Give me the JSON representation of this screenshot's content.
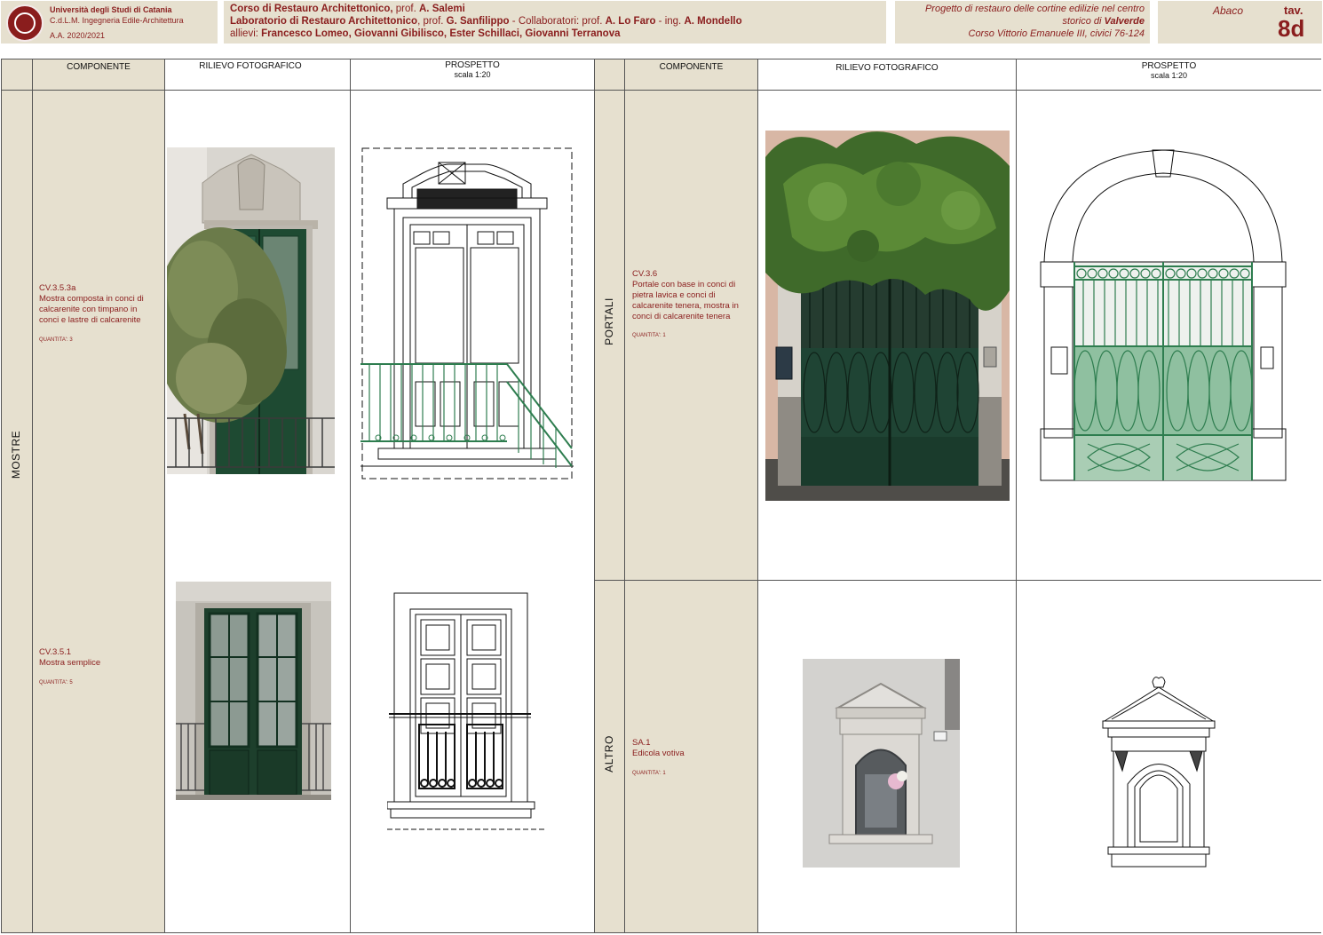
{
  "header": {
    "university": "Università degli Studi di Catania",
    "degree": "C.d.L.M. Ingegneria Edile-Architettura",
    "year": "A.A. 2020/2021",
    "course_line1_a": "Corso di Restauro Architettonico,",
    "course_line1_b": " prof. ",
    "course_line1_c": "A. Salemi",
    "course_line2_a": "Laboratorio di Restauro Architettonico",
    "course_line2_b": ", prof. ",
    "course_line2_c": "G. Sanfilippo",
    "course_line2_d": " - Collaboratori: prof. ",
    "course_line2_e": "A. Lo Faro",
    "course_line2_f": " - ing. ",
    "course_line2_g": "A. Mondello",
    "course_line3_a": "allievi: ",
    "course_line3_b": " Francesco Lomeo, Giovanni Gibilisco, Ester Schillaci, Giovanni Terranova",
    "project_line1": "Progetto di restauro delle cortine edilizie nel centro",
    "project_line2_a": "storico di ",
    "project_line2_b": "Valverde",
    "project_line3": "Corso Vittorio Emanuele III, civici 76-124",
    "abaco": "Abaco",
    "tav_label": "tav.",
    "tav_number": "8d"
  },
  "columns": {
    "componente": "COMPONENTE",
    "rilievo": "RILIEVO FOTOGRAFICO",
    "prospetto": "PROSPETTO",
    "scala": "scala 1:20"
  },
  "sections": {
    "mostre": "MOSTRE",
    "portali": "PORTALI",
    "altro": "ALTRO"
  },
  "items": [
    {
      "code": "CV.3.5.3a",
      "desc_lines": [
        "Mostra composta in conci di",
        "calcarenite con timpano in",
        "conci e lastre di calcarenite"
      ],
      "qty": "QUANTITA': 3"
    },
    {
      "code": "CV.3.5.1",
      "desc_lines": [
        "Mostra semplice"
      ],
      "qty": "QUANTITA': 5"
    },
    {
      "code": "CV.3.6",
      "desc_lines": [
        "Portale con base in conci di",
        "pietra lavica e conci di",
        "calcarenite tenera, mostra in",
        "conci di calcarenite tenera"
      ],
      "qty": "QUANTITA': 1"
    },
    {
      "code": "SA.1",
      "desc_lines": [
        "Edicola votiva"
      ],
      "qty": "QUANTITA': 1"
    }
  ],
  "colors": {
    "beige": "#e6e0cf",
    "accent": "#8a1d1d",
    "ironwork_green": "#2e7d4f",
    "door_green": "#1f4d33"
  }
}
